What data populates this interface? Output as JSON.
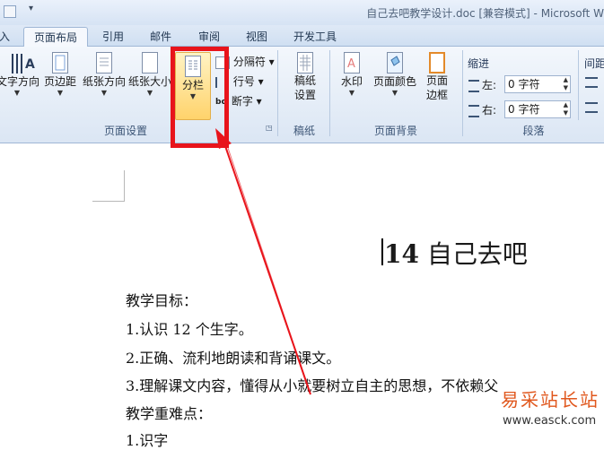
{
  "window": {
    "title": "自己去吧教学设计.doc [兼容模式] - Microsoft W"
  },
  "qat": {
    "dropdown_glyph": "▾"
  },
  "tabs": [
    {
      "label": "入"
    },
    {
      "label": "页面布局"
    },
    {
      "label": "引用"
    },
    {
      "label": "邮件"
    },
    {
      "label": "审阅"
    },
    {
      "label": "视图"
    },
    {
      "label": "开发工具"
    }
  ],
  "active_tab_index": 1,
  "ribbon": {
    "page_setup": {
      "label": "页面设置",
      "buttons": [
        {
          "label": "文字方向",
          "icon": "text-direction-icon"
        },
        {
          "label": "页边距",
          "icon": "margins-icon"
        },
        {
          "label": "纸张方向",
          "icon": "orientation-icon"
        },
        {
          "label": "纸张大小",
          "icon": "paper-size-icon"
        },
        {
          "label": "分栏",
          "icon": "columns-icon"
        }
      ],
      "small_buttons": [
        {
          "label": "分隔符 ▾",
          "icon": "breaks-icon"
        },
        {
          "label": "行号 ▾",
          "icon": "line-numbers-icon"
        },
        {
          "label": "断字 ▾",
          "icon": "hyphenation-icon"
        }
      ]
    },
    "manuscript": {
      "label": "稿纸",
      "button": "稿纸\n设置"
    },
    "page_background": {
      "label": "页面背景",
      "buttons": [
        {
          "label": "水印"
        },
        {
          "label": "页面颜色"
        },
        {
          "label": "页面\n边框"
        }
      ]
    },
    "paragraph": {
      "label": "段落",
      "indent_title": "缩进",
      "spacing_title": "间距",
      "left_label": "左:",
      "left_value": "0 字符",
      "right_label": "右:",
      "right_value": "0 字符"
    }
  },
  "document": {
    "title_number": "14",
    "title_text": " 自己去吧",
    "lines": [
      "教学目标：",
      "1.认识 12 个生字。",
      "2.正确、流利地朗读和背诵课文。",
      "3.理解课文内容，懂得从小就要树立自主的思想，不依赖父",
      "教学重难点：",
      "1.识字"
    ]
  },
  "watermark": {
    "cn": "易采站长站",
    "url": "www.easck.com"
  },
  "colors": {
    "highlight": "#e8141b",
    "ribbon_bg": "#dbe6f4",
    "tab_text": "#1f3550"
  }
}
